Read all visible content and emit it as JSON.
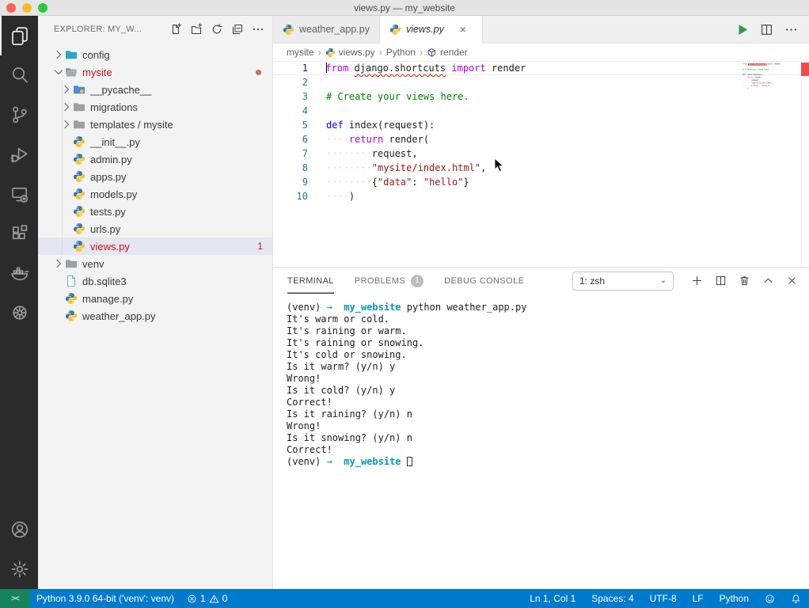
{
  "window": {
    "title": "views.py — my_website"
  },
  "activity_bar": {
    "items": [
      {
        "name": "explorer",
        "active": true
      },
      {
        "name": "search"
      },
      {
        "name": "source-control"
      },
      {
        "name": "run-debug"
      },
      {
        "name": "remote-explorer"
      },
      {
        "name": "extensions"
      },
      {
        "name": "docker"
      },
      {
        "name": "kubernetes"
      }
    ],
    "bottom_items": [
      {
        "name": "account"
      },
      {
        "name": "settings"
      }
    ]
  },
  "sidebar": {
    "header": "EXPLORER: MY_W...",
    "header_actions": [
      "new-file",
      "new-folder",
      "refresh",
      "collapse-all",
      "more"
    ],
    "tree": [
      {
        "label": "config",
        "icon": "folder-config",
        "chevron": "right",
        "level": 0
      },
      {
        "label": "mysite",
        "icon": "folder-open",
        "chevron": "down",
        "level": 0,
        "red": true,
        "dot": true
      },
      {
        "label": "__pycache__",
        "icon": "folder-pycache",
        "chevron": "right",
        "level": 1
      },
      {
        "label": "migrations",
        "icon": "folder-gray",
        "chevron": "right",
        "level": 1
      },
      {
        "label": "templates / mysite",
        "icon": "folder-gray",
        "chevron": "right",
        "level": 1
      },
      {
        "label": "__init__.py",
        "icon": "py",
        "level": 1
      },
      {
        "label": "admin.py",
        "icon": "py",
        "level": 1
      },
      {
        "label": "apps.py",
        "icon": "py",
        "level": 1
      },
      {
        "label": "models.py",
        "icon": "py",
        "level": 1
      },
      {
        "label": "tests.py",
        "icon": "py",
        "level": 1
      },
      {
        "label": "urls.py",
        "icon": "py",
        "level": 1
      },
      {
        "label": "views.py",
        "icon": "py",
        "level": 1,
        "red": true,
        "selected": true,
        "badge": "1"
      },
      {
        "label": "venv",
        "icon": "folder-gray",
        "chevron": "right",
        "level": 0
      },
      {
        "label": "db.sqlite3",
        "icon": "db",
        "level": 0
      },
      {
        "label": "manage.py",
        "icon": "py",
        "level": 0
      },
      {
        "label": "weather_app.py",
        "icon": "py",
        "level": 0
      }
    ]
  },
  "editor": {
    "tabs": [
      {
        "label": "weather_app.py",
        "icon": "py",
        "active": false,
        "italic": false
      },
      {
        "label": "views.py",
        "icon": "py",
        "active": true,
        "italic": true,
        "close": "×"
      }
    ],
    "actions": [
      "run",
      "split-editor",
      "more"
    ],
    "breadcrumb": [
      {
        "label": "mysite"
      },
      {
        "label": "views.py",
        "icon": "py"
      },
      {
        "label": "Python"
      },
      {
        "label": "render",
        "icon": "symbol-cube"
      }
    ],
    "lines": [
      {
        "n": "1",
        "current": true,
        "tokens": [
          {
            "c": "cursor",
            "t": ""
          },
          {
            "c": "kw",
            "t": "from"
          },
          {
            "c": "pl",
            "t": " "
          },
          {
            "c": "err",
            "t": "django.shortcuts"
          },
          {
            "c": "pl",
            "t": " "
          },
          {
            "c": "kw",
            "t": "import"
          },
          {
            "c": "pl",
            "t": " render"
          }
        ]
      },
      {
        "n": "2",
        "tokens": []
      },
      {
        "n": "3",
        "tokens": [
          {
            "c": "cm",
            "t": "# Create your views here."
          }
        ]
      },
      {
        "n": "4",
        "tokens": []
      },
      {
        "n": "5",
        "tokens": [
          {
            "c": "kwb",
            "t": "def"
          },
          {
            "c": "pl",
            "t": " index(request):"
          }
        ]
      },
      {
        "n": "6",
        "tokens": [
          {
            "c": "ws",
            "t": "····"
          },
          {
            "c": "kw",
            "t": "return"
          },
          {
            "c": "pl",
            "t": " render("
          }
        ]
      },
      {
        "n": "7",
        "tokens": [
          {
            "c": "ws",
            "t": "········"
          },
          {
            "c": "pl",
            "t": "request,"
          }
        ]
      },
      {
        "n": "8",
        "tokens": [
          {
            "c": "ws",
            "t": "········"
          },
          {
            "c": "str",
            "t": "\"mysite/index.html\""
          },
          {
            "c": "pl",
            "t": ","
          }
        ]
      },
      {
        "n": "9",
        "tokens": [
          {
            "c": "ws",
            "t": "········"
          },
          {
            "c": "pl",
            "t": "{"
          },
          {
            "c": "str",
            "t": "\"data\""
          },
          {
            "c": "pl",
            "t": ": "
          },
          {
            "c": "str",
            "t": "\"hello\""
          },
          {
            "c": "pl",
            "t": "}"
          }
        ]
      },
      {
        "n": "10",
        "tokens": [
          {
            "c": "ws",
            "t": "····"
          },
          {
            "c": "pl",
            "t": ")"
          }
        ]
      }
    ]
  },
  "panel": {
    "tabs": [
      {
        "label": "TERMINAL",
        "active": true
      },
      {
        "label": "PROBLEMS",
        "badge": "1"
      },
      {
        "label": "DEBUG CONSOLE"
      }
    ],
    "dropdown": {
      "value": "1: zsh"
    },
    "actions": [
      "new-terminal",
      "split-terminal",
      "kill-terminal",
      "maximize-panel",
      "close-panel"
    ],
    "terminal": [
      [
        {
          "c": "pl",
          "t": "(venv) "
        },
        {
          "c": "green",
          "t": "→"
        },
        {
          "c": "pl",
          "t": "  "
        },
        {
          "c": "cyan",
          "t": "my_website"
        },
        {
          "c": "pl",
          "t": " python weather_app.py"
        }
      ],
      [
        {
          "c": "pl",
          "t": "It's warm or cold."
        }
      ],
      [
        {
          "c": "pl",
          "t": "It's raining or warm."
        }
      ],
      [
        {
          "c": "pl",
          "t": "It's raining or snowing."
        }
      ],
      [
        {
          "c": "pl",
          "t": "It's cold or snowing."
        }
      ],
      [
        {
          "c": "pl",
          "t": "Is it warm? (y/n) y"
        }
      ],
      [
        {
          "c": "pl",
          "t": "Wrong!"
        }
      ],
      [
        {
          "c": "pl",
          "t": "Is it cold? (y/n) y"
        }
      ],
      [
        {
          "c": "pl",
          "t": "Correct!"
        }
      ],
      [
        {
          "c": "pl",
          "t": "Is it raining? (y/n) n"
        }
      ],
      [
        {
          "c": "pl",
          "t": "Wrong!"
        }
      ],
      [
        {
          "c": "pl",
          "t": "Is it snowing? (y/n) n"
        }
      ],
      [
        {
          "c": "pl",
          "t": "Correct!"
        }
      ],
      [
        {
          "c": "pl",
          "t": "(venv) "
        },
        {
          "c": "green",
          "t": "→"
        },
        {
          "c": "pl",
          "t": "  "
        },
        {
          "c": "cyan",
          "t": "my_website"
        },
        {
          "c": "pl",
          "t": " "
        },
        {
          "c": "tcursor",
          "t": ""
        }
      ]
    ]
  },
  "status_bar": {
    "remote": "><",
    "interpreter": "Python 3.9.0 64-bit ('venv': venv)",
    "problems": {
      "errors": "1",
      "warnings": "0"
    },
    "right": [
      "Ln 1, Col 1",
      "Spaces: 4",
      "UTF-8",
      "LF",
      "Python"
    ],
    "right_icons": [
      "feedback",
      "bell"
    ]
  },
  "colors": {
    "accent": "#007acc",
    "remote_green": "#16825d",
    "error_red": "#e51400",
    "terminal_cyan": "#0598bc",
    "terminal_green": "#1da33c",
    "selection_bg": "#e4e6f1",
    "tree_error_red": "#c01518"
  }
}
